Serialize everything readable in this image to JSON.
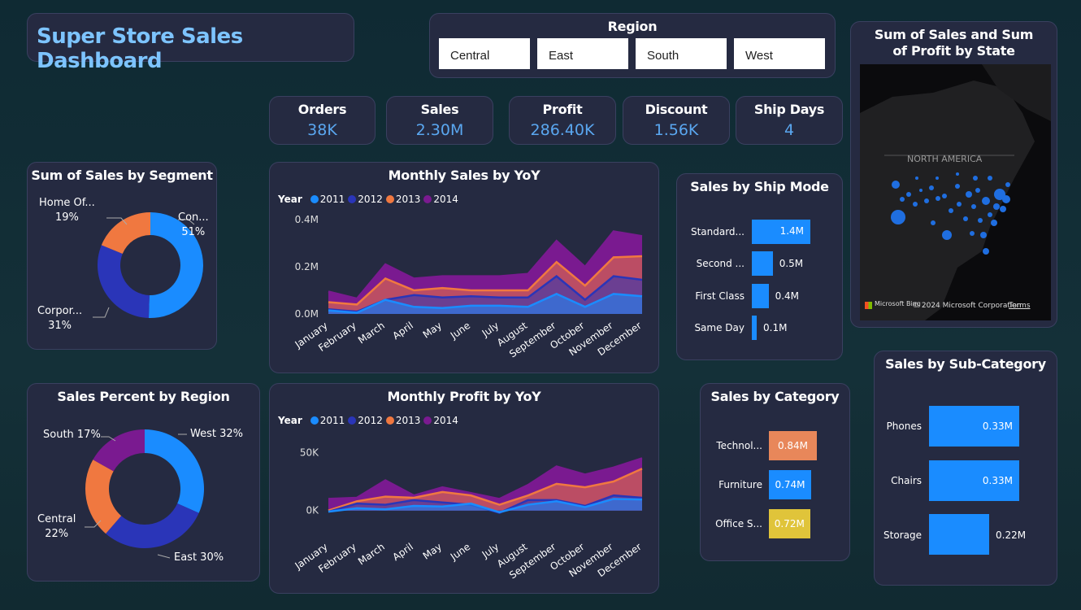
{
  "title": "Super Store Sales Dashboard",
  "region_slicer": {
    "title": "Region",
    "options": [
      "Central",
      "East",
      "South",
      "West"
    ]
  },
  "kpis": [
    {
      "label": "Orders",
      "value": "38K"
    },
    {
      "label": "Sales",
      "value": "2.30M"
    },
    {
      "label": "Profit",
      "value": "286.40K"
    },
    {
      "label": "Discount",
      "value": "1.56K"
    },
    {
      "label": "Ship Days",
      "value": "4"
    }
  ],
  "map": {
    "title": "Sum of Sales and Sum of Profit by State",
    "region_label": "NORTH AMERICA",
    "attribution": "© 2024 Microsoft Corporation",
    "terms": "Terms",
    "brand": "Microsoft Bing"
  },
  "colors": {
    "accent": "#1a8cff",
    "navy": "#2a35b8",
    "orange": "#f07840",
    "purple": "#7a1a90",
    "tan": "#e8875a",
    "gold": "#e0c43a"
  },
  "chart_data": [
    {
      "type": "pie",
      "title": "Sum of Sales by Segment",
      "labels": [
        "Con...",
        "Corpor...",
        "Home Of..."
      ],
      "values": [
        51,
        31,
        19
      ],
      "colors": [
        "#1a8cff",
        "#2a35b8",
        "#f07840"
      ]
    },
    {
      "type": "area",
      "title": "Monthly Sales by YoY",
      "legend_title": "Year",
      "categories": [
        "January",
        "February",
        "March",
        "April",
        "May",
        "June",
        "July",
        "August",
        "September",
        "October",
        "November",
        "December"
      ],
      "ylim": [
        0,
        0.4
      ],
      "yticks": [
        "0.4M",
        "0.2M",
        "0.0M"
      ],
      "series": [
        {
          "name": "2011",
          "color": "#1a8cff",
          "values": [
            0.015,
            0.005,
            0.06,
            0.03,
            0.025,
            0.035,
            0.035,
            0.03,
            0.085,
            0.03,
            0.085,
            0.075
          ]
        },
        {
          "name": "2012",
          "color": "#2a35b8",
          "values": [
            0.02,
            0.01,
            0.06,
            0.08,
            0.07,
            0.075,
            0.07,
            0.07,
            0.16,
            0.06,
            0.16,
            0.145
          ]
        },
        {
          "name": "2013",
          "color": "#f07840",
          "values": [
            0.05,
            0.04,
            0.15,
            0.1,
            0.11,
            0.1,
            0.1,
            0.1,
            0.22,
            0.12,
            0.24,
            0.245
          ]
        },
        {
          "name": "2014",
          "color": "#7a1a90",
          "values": [
            0.095,
            0.065,
            0.21,
            0.15,
            0.16,
            0.16,
            0.16,
            0.17,
            0.31,
            0.2,
            0.35,
            0.33
          ]
        }
      ]
    },
    {
      "type": "bar",
      "title": "Sales by Ship Mode",
      "categories": [
        "Standard...",
        "Second ...",
        "First Class",
        "Same Day"
      ],
      "values": [
        1.4,
        0.5,
        0.4,
        0.1
      ],
      "labels": [
        "1.4M",
        "0.5M",
        "0.4M",
        "0.1M"
      ]
    },
    {
      "type": "pie",
      "title": "Sales Percent by Region",
      "labels": [
        "West 32%",
        "East 30%",
        "Central",
        "South 17%"
      ],
      "sublabels": [
        "",
        "",
        "22%",
        ""
      ],
      "values": [
        32,
        30,
        22,
        17
      ],
      "colors": [
        "#1a8cff",
        "#2a35b8",
        "#f07840",
        "#7a1a90"
      ]
    },
    {
      "type": "area",
      "title": "Monthly Profit by YoY",
      "legend_title": "Year",
      "categories": [
        "January",
        "February",
        "March",
        "April",
        "May",
        "June",
        "July",
        "August",
        "September",
        "October",
        "November",
        "December"
      ],
      "ylim": [
        -10000,
        60000
      ],
      "yticks": [
        "50K",
        "0K"
      ],
      "series": [
        {
          "name": "2011",
          "color": "#1a8cff",
          "values": [
            -1000,
            2000,
            1000,
            4000,
            3500,
            6000,
            -1500,
            5000,
            8000,
            3000,
            10000,
            9500
          ]
        },
        {
          "name": "2012",
          "color": "#2a35b8",
          "values": [
            -1000,
            6000,
            5000,
            9000,
            7000,
            5000,
            -2000,
            9000,
            9000,
            4000,
            13000,
            11000
          ]
        },
        {
          "name": "2013",
          "color": "#f07840",
          "values": [
            0,
            8000,
            12000,
            11000,
            16000,
            13000,
            5000,
            13000,
            23000,
            20000,
            25000,
            36000
          ]
        },
        {
          "name": "2014",
          "color": "#7a1a90",
          "values": [
            10000,
            11000,
            26000,
            13000,
            20000,
            15000,
            10000,
            22000,
            38000,
            31000,
            37000,
            45000
          ]
        }
      ]
    },
    {
      "type": "bar",
      "title": "Sales by Category",
      "categories": [
        "Technol...",
        "Furniture",
        "Office S..."
      ],
      "values": [
        0.84,
        0.74,
        0.72
      ],
      "labels": [
        "0.84M",
        "0.74M",
        "0.72M"
      ],
      "colors": [
        "#e8875a",
        "#1a8cff",
        "#e0c43a"
      ]
    },
    {
      "type": "bar",
      "title": "Sales by Sub-Category",
      "categories": [
        "Phones",
        "Chairs",
        "Storage"
      ],
      "values": [
        0.33,
        0.33,
        0.22
      ],
      "labels": [
        "0.33M",
        "0.33M",
        "0.22M"
      ]
    }
  ]
}
